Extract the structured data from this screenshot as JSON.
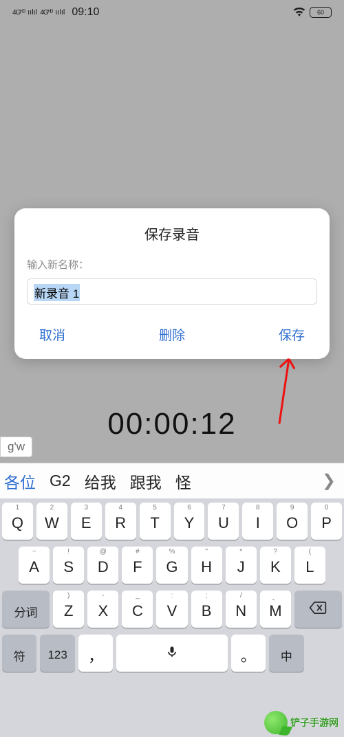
{
  "status": {
    "signal1": "4Gᴴᴰ",
    "signal2": "4Gᴴᴰ",
    "time": "09:10",
    "battery": "60"
  },
  "dialog": {
    "title": "保存录音",
    "input_label": "输入新名称：",
    "input_value": "新录音 1",
    "cancel": "取消",
    "delete": "删除",
    "save": "保存"
  },
  "timer": "00:00:12",
  "ime": {
    "pinyin": "g'w",
    "candidates": [
      "各位",
      "G2",
      "给我",
      "跟我",
      "怪"
    ]
  },
  "keyboard": {
    "row1": [
      {
        "alt": "1",
        "main": "Q"
      },
      {
        "alt": "2",
        "main": "W"
      },
      {
        "alt": "3",
        "main": "E"
      },
      {
        "alt": "4",
        "main": "R"
      },
      {
        "alt": "5",
        "main": "T"
      },
      {
        "alt": "6",
        "main": "Y"
      },
      {
        "alt": "7",
        "main": "U"
      },
      {
        "alt": "8",
        "main": "I"
      },
      {
        "alt": "9",
        "main": "O"
      },
      {
        "alt": "0",
        "main": "P"
      }
    ],
    "row2": [
      {
        "alt": "~",
        "main": "A"
      },
      {
        "alt": "!",
        "main": "S"
      },
      {
        "alt": "@",
        "main": "D"
      },
      {
        "alt": "#",
        "main": "F"
      },
      {
        "alt": "%",
        "main": "G"
      },
      {
        "alt": "\"",
        "main": "H"
      },
      {
        "alt": "*",
        "main": "J"
      },
      {
        "alt": "?",
        "main": "K"
      },
      {
        "alt": "(",
        "main": "L"
      }
    ],
    "row3_func": "分词",
    "row3": [
      {
        "alt": ")",
        "main": "Z"
      },
      {
        "alt": "-",
        "main": "X"
      },
      {
        "alt": "_",
        "main": "C"
      },
      {
        "alt": ":",
        "main": "V"
      },
      {
        "alt": ";",
        "main": "B"
      },
      {
        "alt": "/",
        "main": "N"
      },
      {
        "alt": "、",
        "main": "M"
      }
    ],
    "row4": {
      "sym": "符",
      "num": "123",
      "comma": "，",
      "period": "。",
      "lang": "中"
    }
  },
  "watermark": "铲子手游网"
}
